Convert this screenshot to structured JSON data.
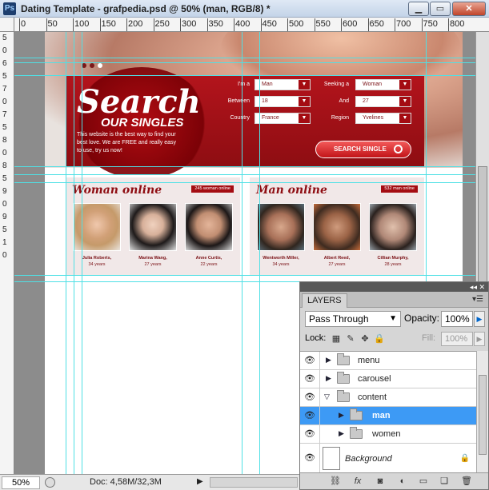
{
  "window": {
    "title": "Dating Template - grafpedia.psd @ 50% (man, RGB/8) *",
    "app_icon": "Ps",
    "minimize": "▁",
    "restore": "▭",
    "close": "✕"
  },
  "ruler": {
    "top_labels": [
      "0",
      "50",
      "100",
      "150",
      "200",
      "250",
      "300",
      "350",
      "400",
      "450",
      "500",
      "550",
      "600",
      "650",
      "700",
      "750",
      "800"
    ],
    "left_labels": [
      "5",
      "0",
      "6",
      "5",
      "7",
      "0",
      "7",
      "5",
      "8",
      "0",
      "8",
      "5",
      "9",
      "0",
      "9",
      "5",
      "1",
      "0"
    ]
  },
  "template": {
    "search_title": "Search",
    "search_subtitle": "OUR SINGLES",
    "search_description": "This website is the best way to find your best love. We are FREE and really easy to use, try us now!",
    "fields": {
      "im_a_label": "I'm a",
      "im_a_value": "Man",
      "seeking_label": "Seeking a",
      "seeking_value": "Woman",
      "between_label": "Between",
      "between_value": "18",
      "and_label": "And",
      "and_value": "27",
      "country_label": "Country",
      "country_value": "France",
      "region_label": "Region",
      "region_value": "Yvelines"
    },
    "search_button": "SEARCH SINGLE",
    "women": {
      "title": "Woman online",
      "badge": "245 woman online",
      "people": [
        {
          "name": "Julia Roberts,",
          "age": "34 years"
        },
        {
          "name": "Marina Wang,",
          "age": "27 years"
        },
        {
          "name": "Anne Curtis,",
          "age": "22 years"
        }
      ]
    },
    "men": {
      "title": "Man online",
      "badge": "532 man online",
      "people": [
        {
          "name": "Wentworth Miller,",
          "age": "34 years"
        },
        {
          "name": "Albert Reed,",
          "age": "27 years"
        },
        {
          "name": "Cillian Murphy,",
          "age": "28 years"
        }
      ]
    }
  },
  "status": {
    "zoom": "50%",
    "doc_info": "Doc: 4,58M/32,3M",
    "arrow": "▶"
  },
  "layers_panel": {
    "tab": "LAYERS",
    "blend_mode": "Pass Through",
    "opacity_label": "Opacity:",
    "opacity_value": "100%",
    "lock_label": "Lock:",
    "fill_label": "Fill:",
    "fill_value": "100%",
    "layers": [
      {
        "name": "menu"
      },
      {
        "name": "carousel"
      },
      {
        "name": "content"
      },
      {
        "name": "man"
      },
      {
        "name": "women"
      }
    ],
    "background_layer": "Background",
    "selected_layer": "man"
  },
  "colors": {
    "accent_red": "#a40c12",
    "guide_cyan": "#4fe0e5",
    "selection_blue": "#3d9af5"
  }
}
